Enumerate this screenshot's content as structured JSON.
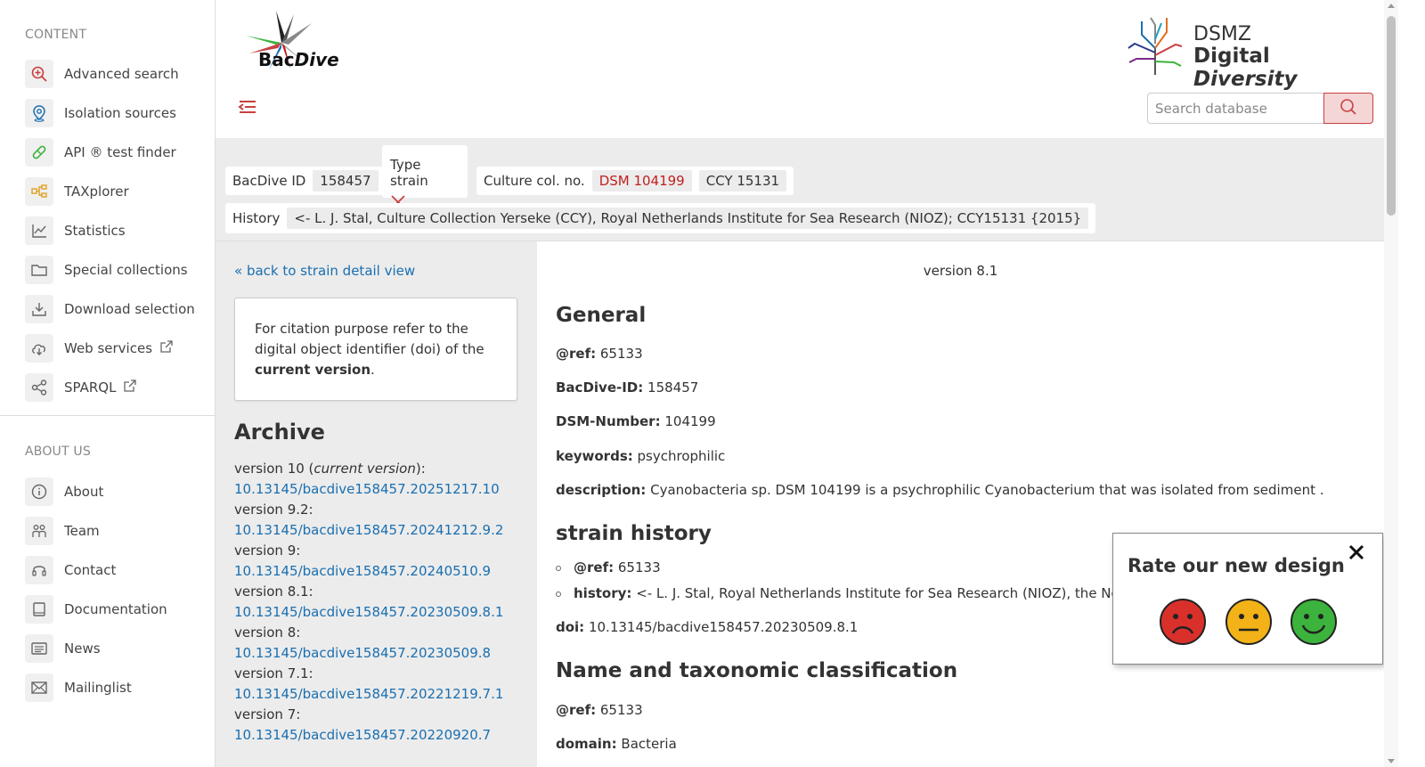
{
  "sidebar": {
    "content_title": "CONTENT",
    "content_items": [
      {
        "label": "Advanced search",
        "icon": "search-plus-icon"
      },
      {
        "label": "Isolation sources",
        "icon": "location-pin-icon"
      },
      {
        "label": "API ® test finder",
        "icon": "pill-icon"
      },
      {
        "label": "TAXplorer",
        "icon": "hierarchy-icon"
      },
      {
        "label": "Statistics",
        "icon": "line-chart-icon"
      },
      {
        "label": "Special collections",
        "icon": "folder-icon"
      },
      {
        "label": "Download selection",
        "icon": "download-icon"
      },
      {
        "label": "Web services",
        "icon": "cloud-download-icon"
      },
      {
        "label": "SPARQL",
        "icon": "share-nodes-icon"
      }
    ],
    "about_title": "ABOUT US",
    "about_items": [
      {
        "label": "About",
        "icon": "info-icon"
      },
      {
        "label": "Team",
        "icon": "team-icon"
      },
      {
        "label": "Contact",
        "icon": "headset-icon"
      },
      {
        "label": "Documentation",
        "icon": "book-icon"
      },
      {
        "label": "News",
        "icon": "newspaper-icon"
      },
      {
        "label": "Mailinglist",
        "icon": "envelope-icon"
      }
    ]
  },
  "header": {
    "logo_text_a": "Bac",
    "logo_text_b": "Dive",
    "dsmz_top": "DSMZ",
    "dsmz_bottom_a": "Digital ",
    "dsmz_bottom_b": "Diversity",
    "search_placeholder": "Search database"
  },
  "strain": {
    "bacdive_id_label": "BacDive ID",
    "bacdive_id": "158457",
    "type_strain_label": "Type strain",
    "culture_label": "Culture col. no.",
    "culture_numbers": [
      "DSM 104199",
      "CCY 15131"
    ],
    "history_label": "History",
    "history_value": "<- L. J. Stal, Culture Collection Yerseke (CCY), Royal Netherlands Institute for Sea Research (NIOZ); CCY15131 {2015}"
  },
  "left": {
    "back_link": "« back to strain detail view",
    "cite_text_a": "For citation purpose refer to the digital object identifier (doi) of the ",
    "cite_text_bold": "current version",
    "cite_text_end": ".",
    "archive_title": "Archive",
    "archive": [
      {
        "version": "version 10 (",
        "note": "current version",
        "suffix": "):",
        "doi": "10.13145/bacdive158457.20251217.10"
      },
      {
        "version": "version 9.2:",
        "note": "",
        "suffix": "",
        "doi": "10.13145/bacdive158457.20241212.9.2"
      },
      {
        "version": "version 9:",
        "note": "",
        "suffix": "",
        "doi": "10.13145/bacdive158457.20240510.9"
      },
      {
        "version": "version 8.1:",
        "note": "",
        "suffix": "",
        "doi": "10.13145/bacdive158457.20230509.8.1"
      },
      {
        "version": "version 8:",
        "note": "",
        "suffix": "",
        "doi": "10.13145/bacdive158457.20230509.8"
      },
      {
        "version": "version 7.1:",
        "note": "",
        "suffix": "",
        "doi": "10.13145/bacdive158457.20221219.7.1"
      },
      {
        "version": "version 7:",
        "note": "",
        "suffix": "",
        "doi": "10.13145/bacdive158457.20220920.7"
      }
    ]
  },
  "main": {
    "version": "version 8.1",
    "general_title": "General",
    "ref_label": "@ref:",
    "ref_value": "65133",
    "bacdive_id_label": "BacDive-ID:",
    "bacdive_id_value": "158457",
    "dsm_label": "DSM-Number:",
    "dsm_value": "104199",
    "keywords_label": "keywords:",
    "keywords_value": "psychrophilic",
    "description_label": "description:",
    "description_value": "Cyanobacteria sp. DSM 104199 is a psychrophilic Cyanobacterium that was isolated from sediment .",
    "strain_history_title": "strain history",
    "sh_ref_label": "@ref:",
    "sh_ref_value": "65133",
    "sh_history_label": "history:",
    "sh_history_value": "<- L. J. Stal, Royal Netherlands Institute for Sea Research (NIOZ), the Netherl",
    "doi_label": "doi:",
    "doi_value": "10.13145/bacdive158457.20230509.8.1",
    "taxonomy_title": "Name and taxonomic classification",
    "tax_ref_label": "@ref:",
    "tax_ref_value": "65133",
    "domain_label": "domain:",
    "domain_value": "Bacteria"
  },
  "rating": {
    "title": "Rate our new design"
  },
  "colors": {
    "accent_red": "#c94040",
    "link_blue": "#1a6fb0",
    "face_sad": "#d9302c",
    "face_neutral": "#f2b218",
    "face_happy": "#3cb33c"
  }
}
